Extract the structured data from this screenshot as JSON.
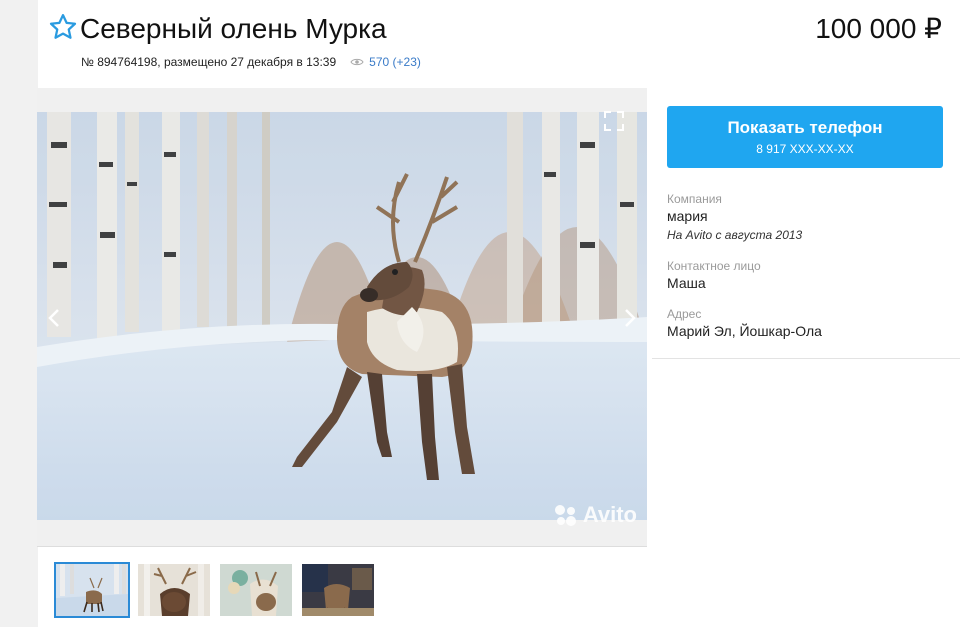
{
  "listing": {
    "title": "Северный олень Мурка",
    "price": "100 000 ₽",
    "meta": {
      "number_and_date": "№ 894764198, размещено 27 декабря в 13:39",
      "views": "570 (+23)"
    }
  },
  "gallery": {
    "watermark": "Avito",
    "thumbnail_count": 4,
    "active_thumbnail": 1
  },
  "seller": {
    "phone_button": {
      "label": "Показать телефон",
      "number": "8 917 XXX-XX-XX",
      "color": "#1fa6f0"
    },
    "company_caption": "Компания",
    "company_name": "мария",
    "on_avito_since": "На Avito с августа 2013",
    "contact_caption": "Контактное лицо",
    "contact_name": "Маша",
    "address_caption": "Адрес",
    "address": "Марий Эл, Йошкар-Ола"
  },
  "icons": {
    "favorite": "star-icon",
    "views": "eye-icon",
    "fullscreen": "fullscreen-icon",
    "prev": "chevron-left-icon",
    "next": "chevron-right-icon"
  }
}
